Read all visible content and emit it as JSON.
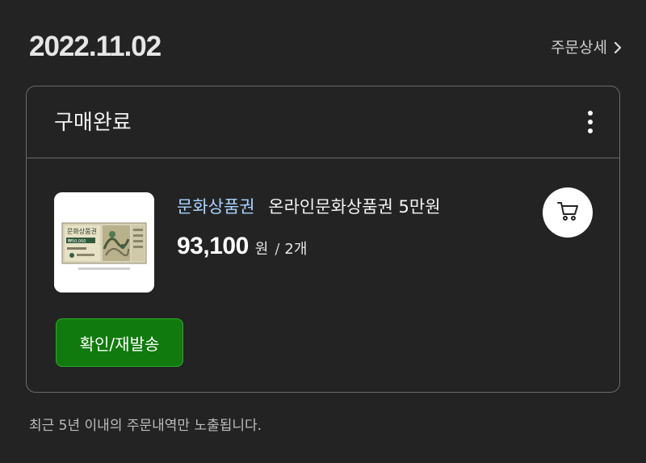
{
  "order": {
    "date": "2022.11.02",
    "detail_label": "주문상세"
  },
  "card": {
    "status": "구매완료",
    "product": {
      "brand": "문화상품권",
      "name": "온라인문화상품권 5만원",
      "price": "93,100",
      "currency": "원",
      "separator": "/",
      "quantity": "2개",
      "thumbnail_text": "문화상품권"
    },
    "resend_label": "확인/재발송"
  },
  "footnote": "최근 5년 이내의 주문내역만 노출됩니다.",
  "icons": {
    "detail": "chevron-right-icon",
    "more": "more-vertical-icon",
    "cart": "cart-icon"
  },
  "colors": {
    "background": "#232323",
    "card_border": "#6b6b6b",
    "brand_link": "#a9d3ff",
    "resend_button": "#117a0e"
  }
}
